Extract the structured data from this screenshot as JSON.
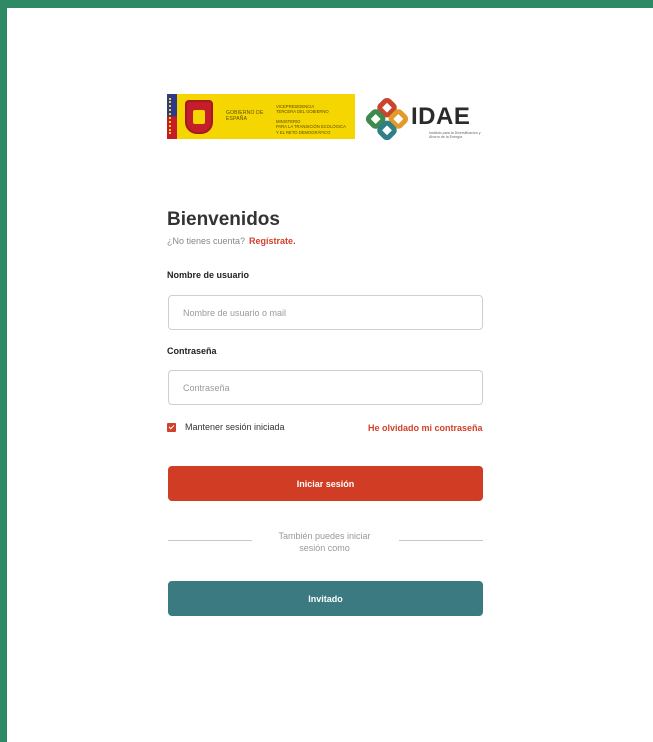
{
  "header": {
    "gov_logo": {
      "gobierno": "GOBIERNO DE ESPAÑA",
      "ministry_lines": [
        "VICEPRESIDENCIA",
        "TERCERA DEL GOBIERNO",
        "MINISTERIO",
        "PARA LA TRANSICIÓN ECOLÓGICA",
        "Y EL RETO DEMOGRÁFICO"
      ]
    },
    "idae_logo": {
      "name": "IDAE",
      "subtitle": "Instituto para la Diversificación y Ahorro de la Energía"
    }
  },
  "form": {
    "title": "Bienvenidos",
    "signup_prompt": "¿No tienes cuenta?",
    "signup_link": "Regístrate.",
    "username_label": "Nombre de usuario",
    "username_placeholder": "Nombre de usuario o mail",
    "username_value": "",
    "password_label": "Contraseña",
    "password_placeholder": "Contraseña",
    "password_value": "",
    "remember_label": "Mantener sesión iniciada",
    "remember_checked": true,
    "forgot_link": "He olvidado mi contraseña",
    "login_button": "Iniciar sesión",
    "divider_text": "También puedes iniciar sesión como",
    "guest_button": "Invitado"
  },
  "colors": {
    "background": "#2e8a64",
    "primary_button": "#d13c25",
    "guest_button": "#3b7a80",
    "link": "#d2402b"
  }
}
